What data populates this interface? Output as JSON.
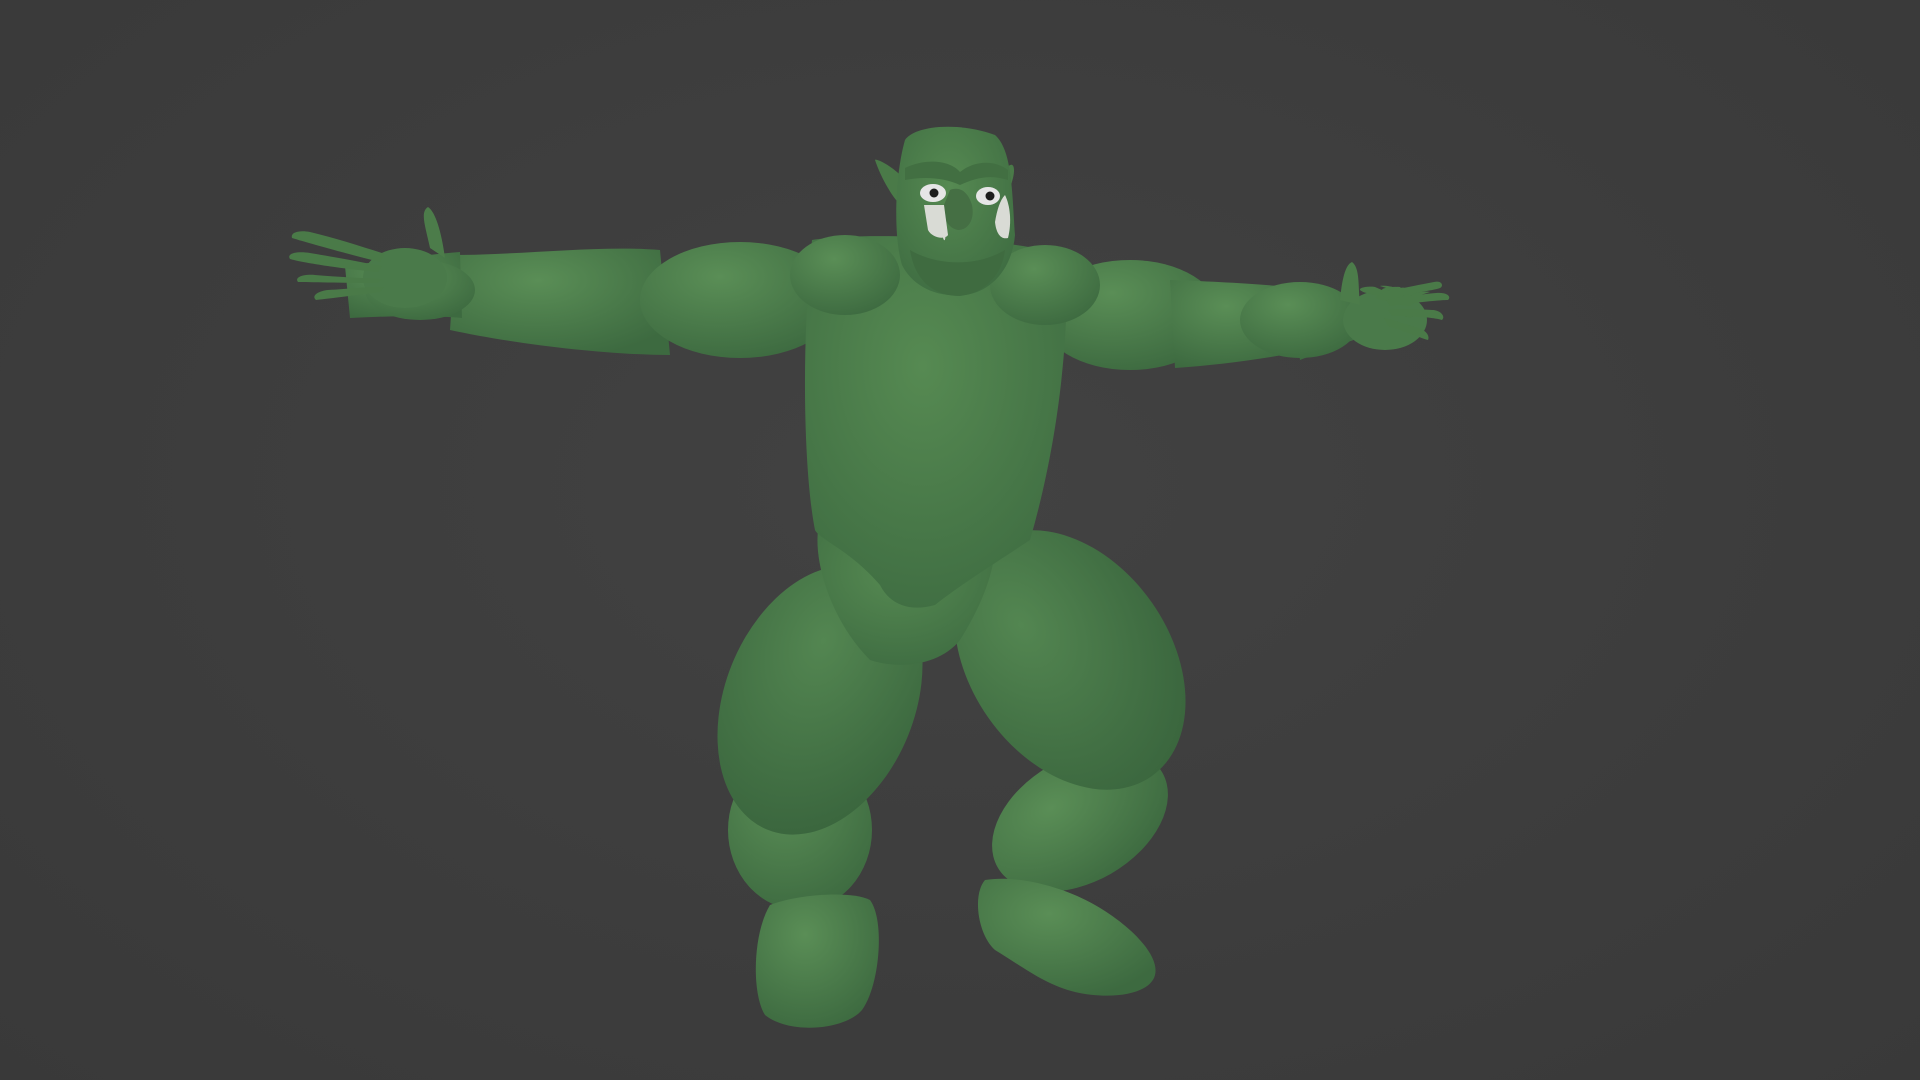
{
  "viewport": {
    "background": "#3d3d3d"
  },
  "model": {
    "subject": "orc",
    "pose": "t-pose",
    "skin_color": "#4a7a4a",
    "skin_shadow": "#3c6a40",
    "skin_highlight": "#5c8c58",
    "eye_color": "#e6e6e6",
    "tusk_color": "#d6d8d2"
  }
}
